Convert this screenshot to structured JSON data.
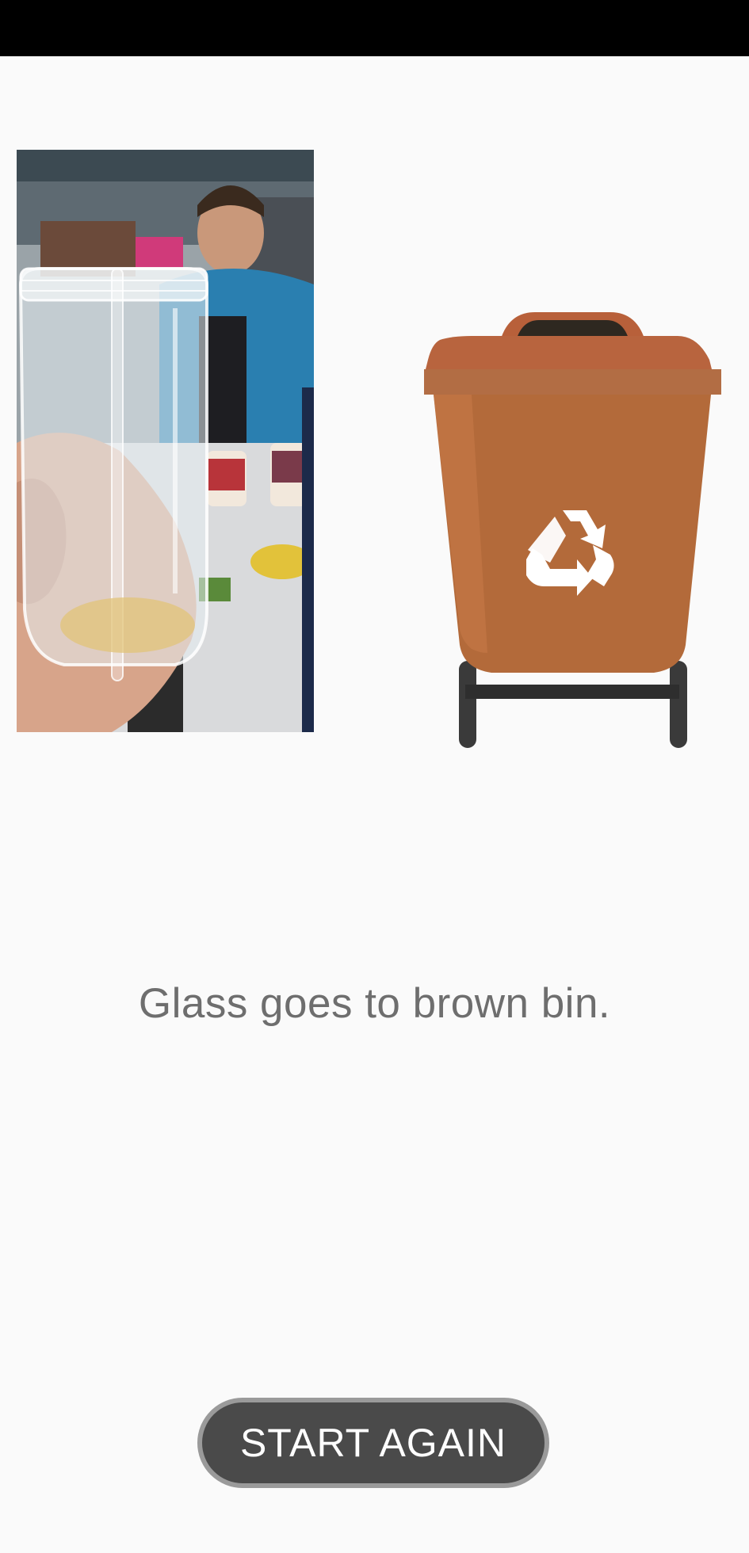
{
  "result": {
    "message": "Glass goes to brown bin.",
    "photo_subject": "glass-jar-photo",
    "bin_color": "#b36a3a",
    "bin_icon": "recycle-icon"
  },
  "actions": {
    "start_again_label": "START AGAIN"
  }
}
